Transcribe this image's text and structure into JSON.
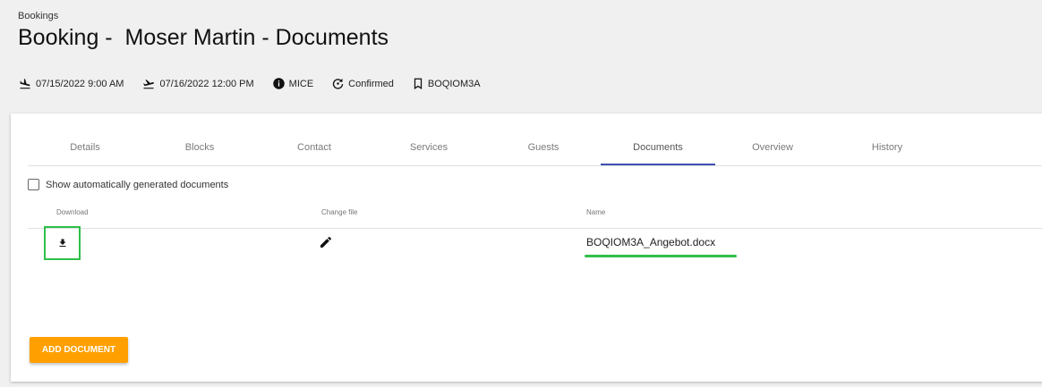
{
  "header": {
    "breadcrumb": "Bookings",
    "title": "Booking -  Moser Martin - Documents",
    "meta": {
      "arrival": "07/15/2022 9:00 AM",
      "departure": "07/16/2022 12:00 PM",
      "type": "MICE",
      "status": "Confirmed",
      "code": "BOQIOM3A"
    }
  },
  "tabs": [
    {
      "label": "Details"
    },
    {
      "label": "Blocks"
    },
    {
      "label": "Contact"
    },
    {
      "label": "Services"
    },
    {
      "label": "Guests"
    },
    {
      "label": "Documents",
      "active": true
    },
    {
      "label": "Overview"
    },
    {
      "label": "History"
    }
  ],
  "documents": {
    "show_generated_label": "Show automatically generated documents",
    "show_generated_checked": false,
    "columns": {
      "download": "Download",
      "change_file": "Change file",
      "name": "Name"
    },
    "rows": [
      {
        "name": "BOQIOM3A_Angebot.docx"
      }
    ],
    "add_button": "ADD DOCUMENT"
  },
  "colors": {
    "accent": "#ffa000",
    "tab_indicator": "#3f51b5",
    "highlight": "#2fbf4a"
  }
}
